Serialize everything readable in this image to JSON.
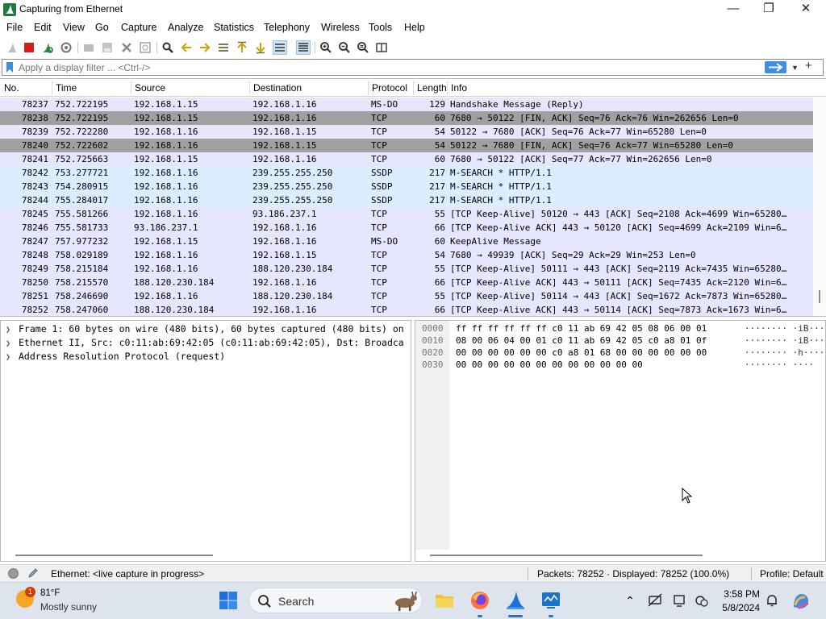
{
  "window": {
    "title": "Capturing from Ethernet"
  },
  "menu": [
    "File",
    "Edit",
    "View",
    "Go",
    "Capture",
    "Analyze",
    "Statistics",
    "Telephony",
    "Wireless",
    "Tools",
    "Help"
  ],
  "filter": {
    "placeholder": "Apply a display filter ... <Ctrl-/>"
  },
  "columns": [
    "No.",
    "Time",
    "Source",
    "Destination",
    "Protocol",
    "Length",
    "Info"
  ],
  "colors": {
    "row_blue": "#e7e6ff",
    "row_gray": "#a0a0a0",
    "row_lightblue": "#daeeff",
    "accent": "#2a6fdb"
  },
  "packets": [
    {
      "no": "78237",
      "time": "752.722195",
      "src": "192.168.1.15",
      "dst": "192.168.1.16",
      "proto": "MS-DO",
      "len": "129",
      "info": "Handshake Message (Reply)",
      "color": "blue"
    },
    {
      "no": "78238",
      "time": "752.722195",
      "src": "192.168.1.15",
      "dst": "192.168.1.16",
      "proto": "TCP",
      "len": "60",
      "info": "7680 → 50122 [FIN, ACK] Seq=76 Ack=76 Win=262656 Len=0",
      "color": "gray"
    },
    {
      "no": "78239",
      "time": "752.722280",
      "src": "192.168.1.16",
      "dst": "192.168.1.15",
      "proto": "TCP",
      "len": "54",
      "info": "50122 → 7680 [ACK] Seq=76 Ack=77 Win=65280 Len=0",
      "color": "blue"
    },
    {
      "no": "78240",
      "time": "752.722602",
      "src": "192.168.1.16",
      "dst": "192.168.1.15",
      "proto": "TCP",
      "len": "54",
      "info": "50122 → 7680 [FIN, ACK] Seq=76 Ack=77 Win=65280 Len=0",
      "color": "gray"
    },
    {
      "no": "78241",
      "time": "752.725663",
      "src": "192.168.1.15",
      "dst": "192.168.1.16",
      "proto": "TCP",
      "len": "60",
      "info": "7680 → 50122 [ACK] Seq=77 Ack=77 Win=262656 Len=0",
      "color": "blue"
    },
    {
      "no": "78242",
      "time": "753.277721",
      "src": "192.168.1.16",
      "dst": "239.255.255.250",
      "proto": "SSDP",
      "len": "217",
      "info": "M-SEARCH * HTTP/1.1",
      "color": "lightblue"
    },
    {
      "no": "78243",
      "time": "754.280915",
      "src": "192.168.1.16",
      "dst": "239.255.255.250",
      "proto": "SSDP",
      "len": "217",
      "info": "M-SEARCH * HTTP/1.1",
      "color": "lightblue"
    },
    {
      "no": "78244",
      "time": "755.284017",
      "src": "192.168.1.16",
      "dst": "239.255.255.250",
      "proto": "SSDP",
      "len": "217",
      "info": "M-SEARCH * HTTP/1.1",
      "color": "lightblue"
    },
    {
      "no": "78245",
      "time": "755.581266",
      "src": "192.168.1.16",
      "dst": "93.186.237.1",
      "proto": "TCP",
      "len": "55",
      "info": "[TCP Keep-Alive] 50120 → 443 [ACK] Seq=2108 Ack=4699 Win=65280…",
      "color": "blue"
    },
    {
      "no": "78246",
      "time": "755.581733",
      "src": "93.186.237.1",
      "dst": "192.168.1.16",
      "proto": "TCP",
      "len": "66",
      "info": "[TCP Keep-Alive ACK] 443 → 50120 [ACK] Seq=4699 Ack=2109 Win=6…",
      "color": "blue"
    },
    {
      "no": "78247",
      "time": "757.977232",
      "src": "192.168.1.15",
      "dst": "192.168.1.16",
      "proto": "MS-DO",
      "len": "60",
      "info": "KeepAlive Message",
      "color": "blue"
    },
    {
      "no": "78248",
      "time": "758.029189",
      "src": "192.168.1.16",
      "dst": "192.168.1.15",
      "proto": "TCP",
      "len": "54",
      "info": "7680 → 49939 [ACK] Seq=29 Ack=29 Win=253 Len=0",
      "color": "blue"
    },
    {
      "no": "78249",
      "time": "758.215184",
      "src": "192.168.1.16",
      "dst": "188.120.230.184",
      "proto": "TCP",
      "len": "55",
      "info": "[TCP Keep-Alive] 50111 → 443 [ACK] Seq=2119 Ack=7435 Win=65280…",
      "color": "blue"
    },
    {
      "no": "78250",
      "time": "758.215570",
      "src": "188.120.230.184",
      "dst": "192.168.1.16",
      "proto": "TCP",
      "len": "66",
      "info": "[TCP Keep-Alive ACK] 443 → 50111 [ACK] Seq=7435 Ack=2120 Win=6…",
      "color": "blue"
    },
    {
      "no": "78251",
      "time": "758.246690",
      "src": "192.168.1.16",
      "dst": "188.120.230.184",
      "proto": "TCP",
      "len": "55",
      "info": "[TCP Keep-Alive] 50114 → 443 [ACK] Seq=1672 Ack=7873 Win=65280…",
      "color": "blue"
    },
    {
      "no": "78252",
      "time": "758.247060",
      "src": "188.120.230.184",
      "dst": "192.168.1.16",
      "proto": "TCP",
      "len": "66",
      "info": "[TCP Keep-Alive ACK] 443 → 50114 [ACK] Seq=7873 Ack=1673 Win=6…",
      "color": "blue"
    }
  ],
  "details": [
    "Frame 1: 60 bytes on wire (480 bits), 60 bytes captured (480 bits) on",
    "Ethernet II, Src: c0:11:ab:69:42:05 (c0:11:ab:69:42:05), Dst: Broadca",
    "Address Resolution Protocol (request)"
  ],
  "bytes": [
    {
      "offset": "0000",
      "hex": "ff ff ff ff ff ff c0 11  ab 69 42 05 08 06 00 01",
      "ascii": "········ ·iB·····"
    },
    {
      "offset": "0010",
      "hex": "08 00 06 04 00 01 c0 11  ab 69 42 05 c0 a8 01 0f",
      "ascii": "········ ·iB·····"
    },
    {
      "offset": "0020",
      "hex": "00 00 00 00 00 00 c0 a8  01 68 00 00 00 00 00 00",
      "ascii": "········ ·h······"
    },
    {
      "offset": "0030",
      "hex": "00 00 00 00 00 00 00 00  00 00 00 00",
      "ascii": "········ ····"
    }
  ],
  "status": {
    "interface": "Ethernet: <live capture in progress>",
    "packets": "Packets: 78252 · Displayed: 78252 (100.0%)",
    "profile": "Profile: Default"
  },
  "taskbar": {
    "weather_temp": "81°F",
    "weather_desc": "Mostly sunny",
    "weather_badge": "1",
    "search_label": "Search",
    "time": "3:58 PM",
    "date": "5/8/2024"
  },
  "icons": {
    "app": "wireshark-fin-icon",
    "toolbar": [
      "shark-fin-start-icon",
      "stop-square-icon",
      "restart-icon",
      "capture-options-gear-icon",
      "open-folder-icon",
      "save-file-icon",
      "close-file-icon",
      "reload-file-icon",
      "find-magnifier-icon",
      "go-back-icon",
      "go-forward-icon",
      "go-to-packet-icon",
      "first-packet-icon",
      "last-packet-icon",
      "autoscroll-icon",
      "colorize-icon",
      "zoom-in-icon",
      "zoom-out-icon",
      "normal-size-icon",
      "resize-columns-icon"
    ]
  }
}
